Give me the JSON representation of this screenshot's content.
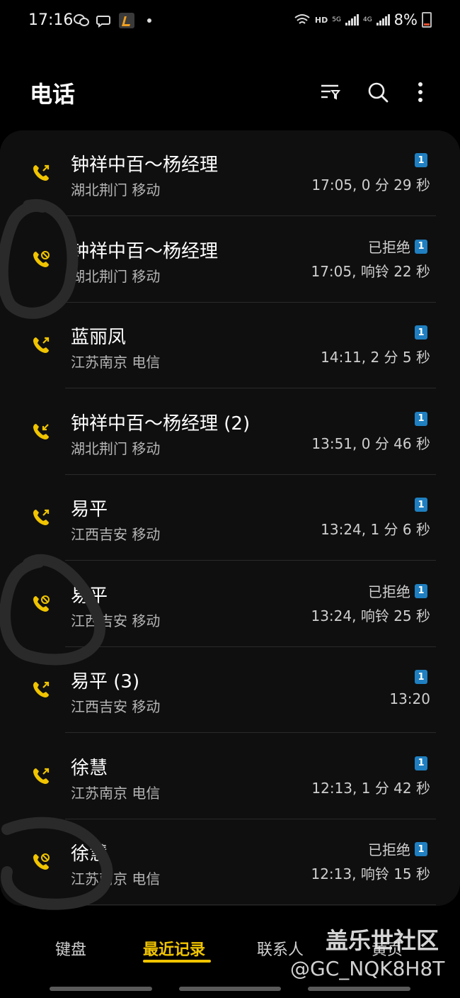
{
  "status_bar": {
    "time": "17:16",
    "network_hd": "HD",
    "net1": "5G",
    "net2": "4G",
    "battery": "8%",
    "icons": [
      "wechat-icon",
      "chat-bubble-icon",
      "app-icon",
      "wifi-icon"
    ]
  },
  "header": {
    "title": "电话",
    "icons": [
      "filter-icon",
      "search-icon",
      "more-icon"
    ]
  },
  "calls": [
    {
      "name": "钟祥中百～杨经理",
      "location": "湖北荆门 移动",
      "status": "",
      "time": "17:05, 0 分 29 秒",
      "sim": "1",
      "type": "outgoing"
    },
    {
      "name": "钟祥中百～杨经理",
      "location": "湖北荆门 移动",
      "status": "已拒绝",
      "time": "17:05, 响铃 22 秒",
      "sim": "1",
      "type": "rejected"
    },
    {
      "name": "蓝丽凤",
      "location": "江苏南京 电信",
      "status": "",
      "time": "14:11, 2 分 5 秒",
      "sim": "1",
      "type": "outgoing"
    },
    {
      "name": "钟祥中百～杨经理 (2)",
      "location": "湖北荆门 移动",
      "status": "",
      "time": "13:51, 0 分 46 秒",
      "sim": "1",
      "type": "incoming"
    },
    {
      "name": "易平",
      "location": "江西吉安 移动",
      "status": "",
      "time": "13:24, 1 分 6 秒",
      "sim": "1",
      "type": "outgoing"
    },
    {
      "name": "易平",
      "location": "江西吉安 移动",
      "status": "已拒绝",
      "time": "13:24, 响铃 25 秒",
      "sim": "1",
      "type": "rejected"
    },
    {
      "name": "易平 (3)",
      "location": "江西吉安 移动",
      "status": "",
      "time": "13:20",
      "sim": "1",
      "type": "outgoing"
    },
    {
      "name": "徐慧",
      "location": "江苏南京 电信",
      "status": "",
      "time": "12:13, 1 分 42 秒",
      "sim": "1",
      "type": "outgoing"
    },
    {
      "name": "徐慧",
      "location": "江苏南京 电信",
      "status": "已拒绝",
      "time": "12:13, 响铃 15 秒",
      "sim": "1",
      "type": "rejected"
    }
  ],
  "tabs": [
    {
      "label": "键盘"
    },
    {
      "label": "最近记录",
      "active": true
    },
    {
      "label": "联系人"
    },
    {
      "label": "黄页"
    }
  ],
  "watermark": {
    "line1": "盖乐世社区",
    "line2": "@GC_NQK8H8T"
  },
  "colors": {
    "accent": "#f0c400",
    "sim_badge": "#1f7fc0",
    "background": "#000000",
    "card": "#0f0f0f"
  }
}
